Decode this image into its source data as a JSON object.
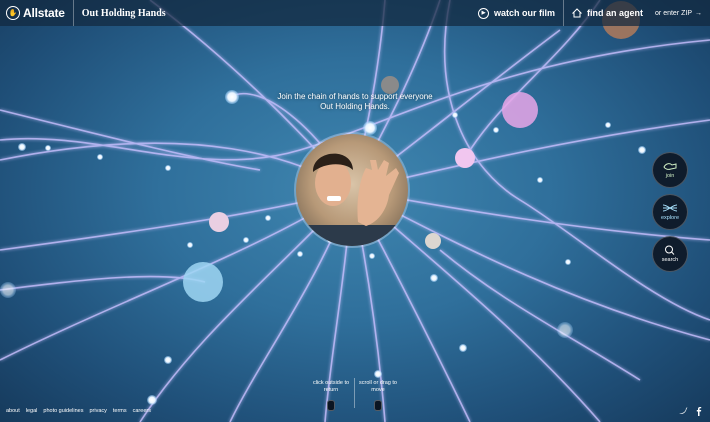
{
  "header": {
    "brand": "Allstate",
    "site_title": "Out Holding Hands",
    "watch_label": "watch our film",
    "agent_label": "find an agent",
    "zip_label": "or enter ZIP"
  },
  "prompt": {
    "line1": "Join the chain of hands to support everyone",
    "line2": "Out Holding Hands."
  },
  "side_buttons": {
    "join": "join",
    "explore": "explore",
    "search": "search"
  },
  "hints": {
    "left_line1": "click outside to",
    "left_line2": "return",
    "right_line1": "scroll or drag to",
    "right_line2": "move"
  },
  "footer": {
    "links": [
      "about",
      "legal",
      "photo guidelines",
      "privacy",
      "terms",
      "careers"
    ]
  },
  "colors": {
    "explore_accent": "#a9e3ff",
    "join_accent": "#cfeec4",
    "header_bg": "#12283e"
  },
  "icons": [
    "play-icon",
    "house-icon",
    "arrow-right-icon",
    "hands-icon",
    "threads-icon",
    "search-icon",
    "twitter-icon",
    "facebook-icon",
    "mouse-icon"
  ]
}
